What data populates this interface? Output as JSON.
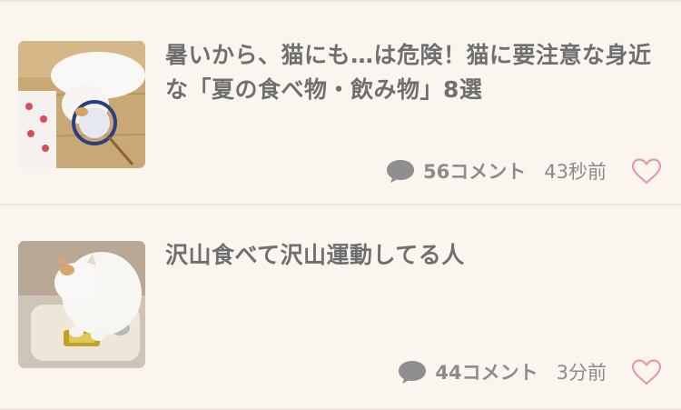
{
  "articles": [
    {
      "title": "暑いから、猫にも…は危険！猫に要注意な身近な「夏の食べ物・飲み物」8選",
      "comment_count": "56コメント",
      "time": "43秒前",
      "thumbnail": "white cat lying on floor with round fan",
      "comment_icon": "speech-bubble-icon",
      "like_icon": "heart-outline-icon"
    },
    {
      "title": "沢山食べて沢山運動してる人",
      "comment_count": "44コメント",
      "time": "3分前",
      "thumbnail": "white cat standing on bathroom scale",
      "comment_icon": "speech-bubble-icon",
      "like_icon": "heart-outline-icon"
    }
  ],
  "colors": {
    "background": "#fbf5ef",
    "text": "#6f6f6f",
    "meta": "#8b8b8b",
    "heart": "#e39aaa",
    "divider": "#efe8e2"
  }
}
